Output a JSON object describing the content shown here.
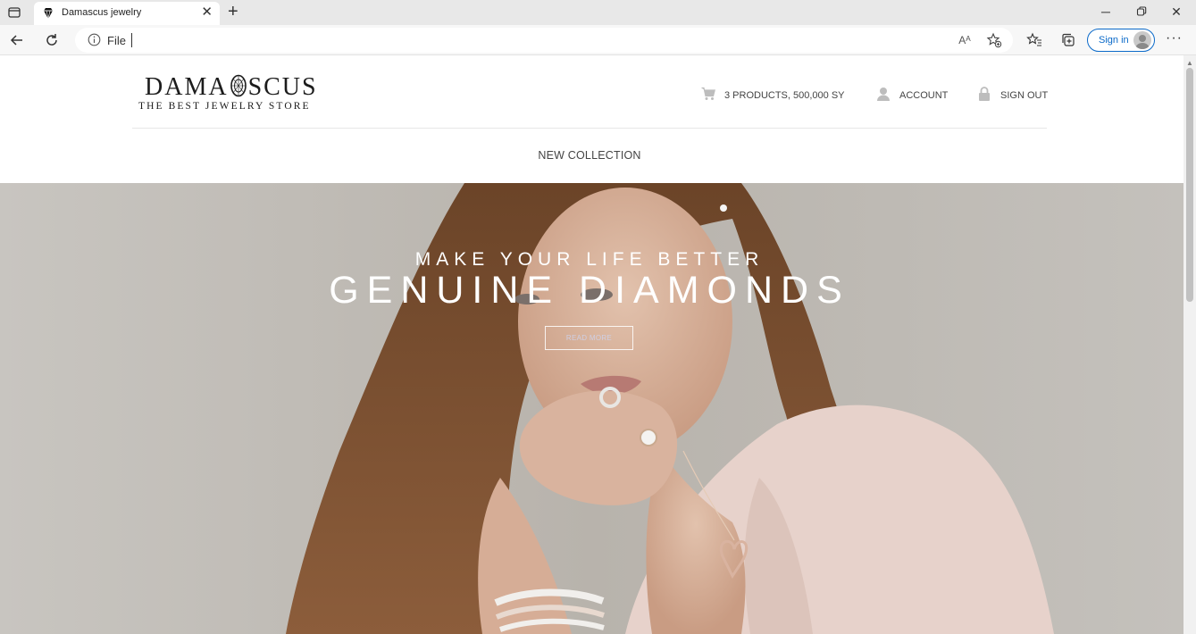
{
  "browser": {
    "tab_title": "Damascus jewelry",
    "address_text": "File",
    "sign_in_label": "Sign in",
    "read_aloud_label": "Aᴬ"
  },
  "site": {
    "logo_text_left": "DAMA",
    "logo_text_right": "SCUS",
    "logo_tagline": "THE BEST JEWELRY STORE",
    "cart_label": "3 PRODUCTS, 500,000 SY",
    "account_label": "ACCOUNT",
    "sign_out_label": "SIGN OUT",
    "nav_new_collection": "NEW COLLECTION"
  },
  "hero": {
    "subtitle": "MAKE YOUR LIFE BETTER",
    "title": "GENUINE DIAMONDS",
    "button_label": "READ MORE"
  },
  "colors": {
    "accent": "#0b6ac9",
    "hero_background": "#c9c6c1",
    "text_dark": "#1c1c1c"
  }
}
